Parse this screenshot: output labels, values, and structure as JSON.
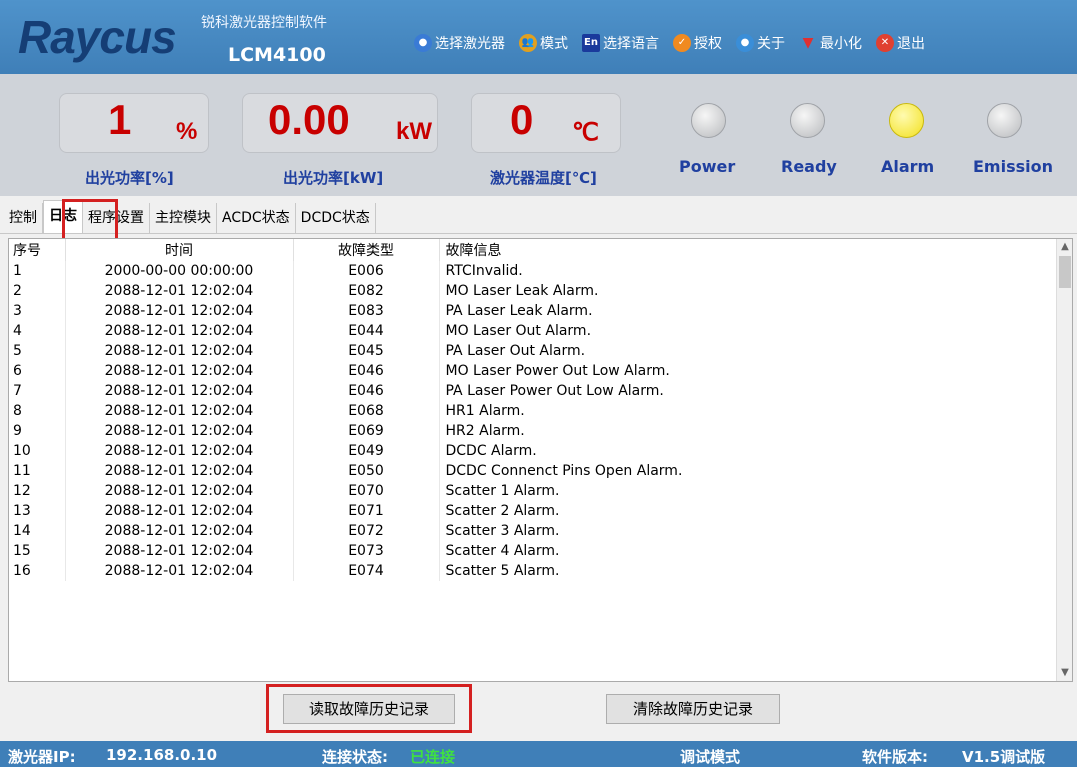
{
  "header": {
    "logo": "Raycus",
    "subtitle": "锐科激光器控制软件",
    "app_name": "LCM4100",
    "menu": [
      {
        "label": "选择激光器",
        "icon": "globe-icon",
        "color": "#3a7bd5"
      },
      {
        "label": "模式",
        "icon": "users-icon",
        "color": "#e0a020"
      },
      {
        "label": "选择语言",
        "icon": "language-icon",
        "color": "#1a3a9c"
      },
      {
        "label": "授权",
        "icon": "check-icon",
        "color": "#f08a20"
      },
      {
        "label": "关于",
        "icon": "info-icon",
        "color": "#3a8ed8"
      },
      {
        "label": "最小化",
        "icon": "minimize-icon",
        "color": "#e03030"
      },
      {
        "label": "退出",
        "icon": "close-icon",
        "color": "#e04030"
      }
    ]
  },
  "display": {
    "power_pct": {
      "value": "1",
      "unit": "%",
      "label": "出光功率[%]"
    },
    "power_kw": {
      "value": "0.00",
      "unit": "kW",
      "label": "出光功率[kW]"
    },
    "temperature": {
      "value": "0",
      "unit": "℃",
      "label": "激光器温度[℃]"
    },
    "leds": [
      {
        "label": "Power",
        "on": false
      },
      {
        "label": "Ready",
        "on": false
      },
      {
        "label": "Alarm",
        "on": true
      },
      {
        "label": "Emission",
        "on": false
      }
    ]
  },
  "tabs": [
    "控制",
    "日志",
    "程序设置",
    "主控模块",
    "ACDC状态",
    "DCDC状态"
  ],
  "active_tab": "日志",
  "log_table": {
    "columns": [
      "序号",
      "时间",
      "故障类型",
      "故障信息"
    ],
    "rows": [
      [
        "1",
        "2000-00-00 00:00:00",
        "E006",
        "RTCInvalid."
      ],
      [
        "2",
        "2088-12-01 12:02:04",
        "E082",
        "MO Laser Leak Alarm."
      ],
      [
        "3",
        "2088-12-01 12:02:04",
        "E083",
        "PA Laser Leak Alarm."
      ],
      [
        "4",
        "2088-12-01 12:02:04",
        "E044",
        "MO Laser Out Alarm."
      ],
      [
        "5",
        "2088-12-01 12:02:04",
        "E045",
        "PA Laser Out Alarm."
      ],
      [
        "6",
        "2088-12-01 12:02:04",
        "E046",
        "MO Laser Power Out Low Alarm."
      ],
      [
        "7",
        "2088-12-01 12:02:04",
        "E046",
        "PA Laser Power Out Low Alarm."
      ],
      [
        "8",
        "2088-12-01 12:02:04",
        "E068",
        "HR1 Alarm."
      ],
      [
        "9",
        "2088-12-01 12:02:04",
        "E069",
        "HR2 Alarm."
      ],
      [
        "10",
        "2088-12-01 12:02:04",
        "E049",
        "DCDC Alarm."
      ],
      [
        "11",
        "2088-12-01 12:02:04",
        "E050",
        "DCDC Connenct Pins Open Alarm."
      ],
      [
        "12",
        "2088-12-01 12:02:04",
        "E070",
        "Scatter 1 Alarm."
      ],
      [
        "13",
        "2088-12-01 12:02:04",
        "E071",
        "Scatter 2 Alarm."
      ],
      [
        "14",
        "2088-12-01 12:02:04",
        "E072",
        "Scatter 3 Alarm."
      ],
      [
        "15",
        "2088-12-01 12:02:04",
        "E073",
        "Scatter 4 Alarm."
      ],
      [
        "16",
        "2088-12-01 12:02:04",
        "E074",
        "Scatter 5 Alarm."
      ]
    ]
  },
  "buttons": {
    "read_history": "读取故障历史记录",
    "clear_history": "清除故障历史记录"
  },
  "status_bar": {
    "ip_label": "激光器IP:",
    "ip_value": "192.168.0.10",
    "conn_label": "连接状态:",
    "conn_value": "已连接",
    "mode": "调试模式",
    "version_label": "软件版本:",
    "version_value": "V1.5调试版"
  }
}
